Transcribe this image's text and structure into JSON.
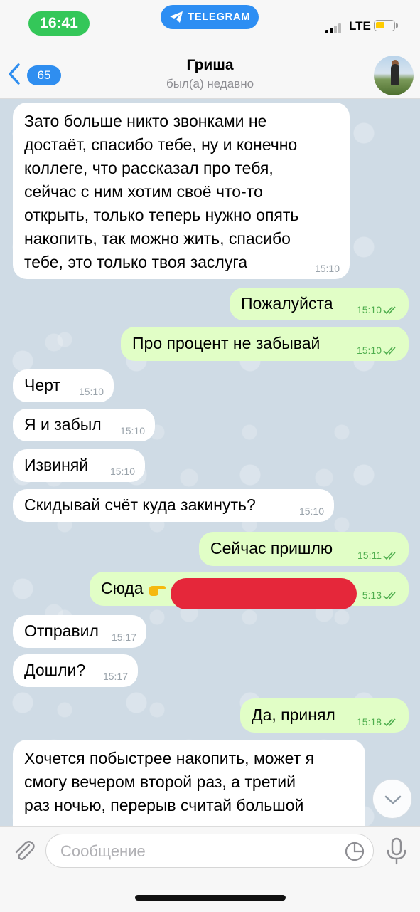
{
  "status_bar": {
    "time": "16:41",
    "app_pill": "TELEGRAM",
    "network": "LTE"
  },
  "header": {
    "back_count": "65",
    "name": "Гриша",
    "status": "был(а) недавно"
  },
  "messages": [
    {
      "dir": "in",
      "lines": [
        "Зато больше никто звонками не",
        "достаёт, спасибо тебе, ну и конечно",
        "коллеге, что рассказал про тебя,",
        "сейчас с ним хотим своё что-то",
        "открыть, только теперь нужно опять",
        "накопить, так можно жить, спасибо",
        "тебе, это только твоя заслуга"
      ],
      "time": "15:10"
    },
    {
      "dir": "out",
      "text": "Пожалуйста",
      "time": "15:10"
    },
    {
      "dir": "out",
      "text": "Про процент не забывай",
      "time": "15:10"
    },
    {
      "dir": "in",
      "text": "Черт",
      "time": "15:10"
    },
    {
      "dir": "in",
      "text": "Я и забыл",
      "time": "15:10"
    },
    {
      "dir": "in",
      "text": "Извиняй",
      "time": "15:10"
    },
    {
      "dir": "in",
      "text": "Скидывай счёт куда закинуть?",
      "time": "15:10"
    },
    {
      "dir": "out",
      "text": "Сейчас пришлю",
      "time": "15:11"
    },
    {
      "dir": "out",
      "text": "Сюда",
      "time": "5:13"
    },
    {
      "dir": "in",
      "text": "Отправил",
      "time": "15:17"
    },
    {
      "dir": "in",
      "text": "Дошли?",
      "time": "15:17"
    },
    {
      "dir": "out",
      "text": "Да, принял",
      "time": "15:18"
    },
    {
      "dir": "in",
      "lines": [
        "Хочется побыстрее накопить, может я",
        "смогу вечером второй раз, а третий",
        "раз ночью, перерыв считай большой"
      ]
    }
  ],
  "input": {
    "placeholder": "Сообщение"
  },
  "colors": {
    "incoming": "#ffffff",
    "outgoing": "#e1fec6",
    "accent": "#2f8ef0",
    "time_pill": "#34c759",
    "redaction": "#e5273a"
  },
  "icons": [
    "back-chevron-icon",
    "telegram-plane-icon",
    "attach-paperclip-icon",
    "sticker-icon",
    "microphone-icon",
    "chevron-down-icon",
    "double-check-icon",
    "pointing-hand-emoji"
  ]
}
